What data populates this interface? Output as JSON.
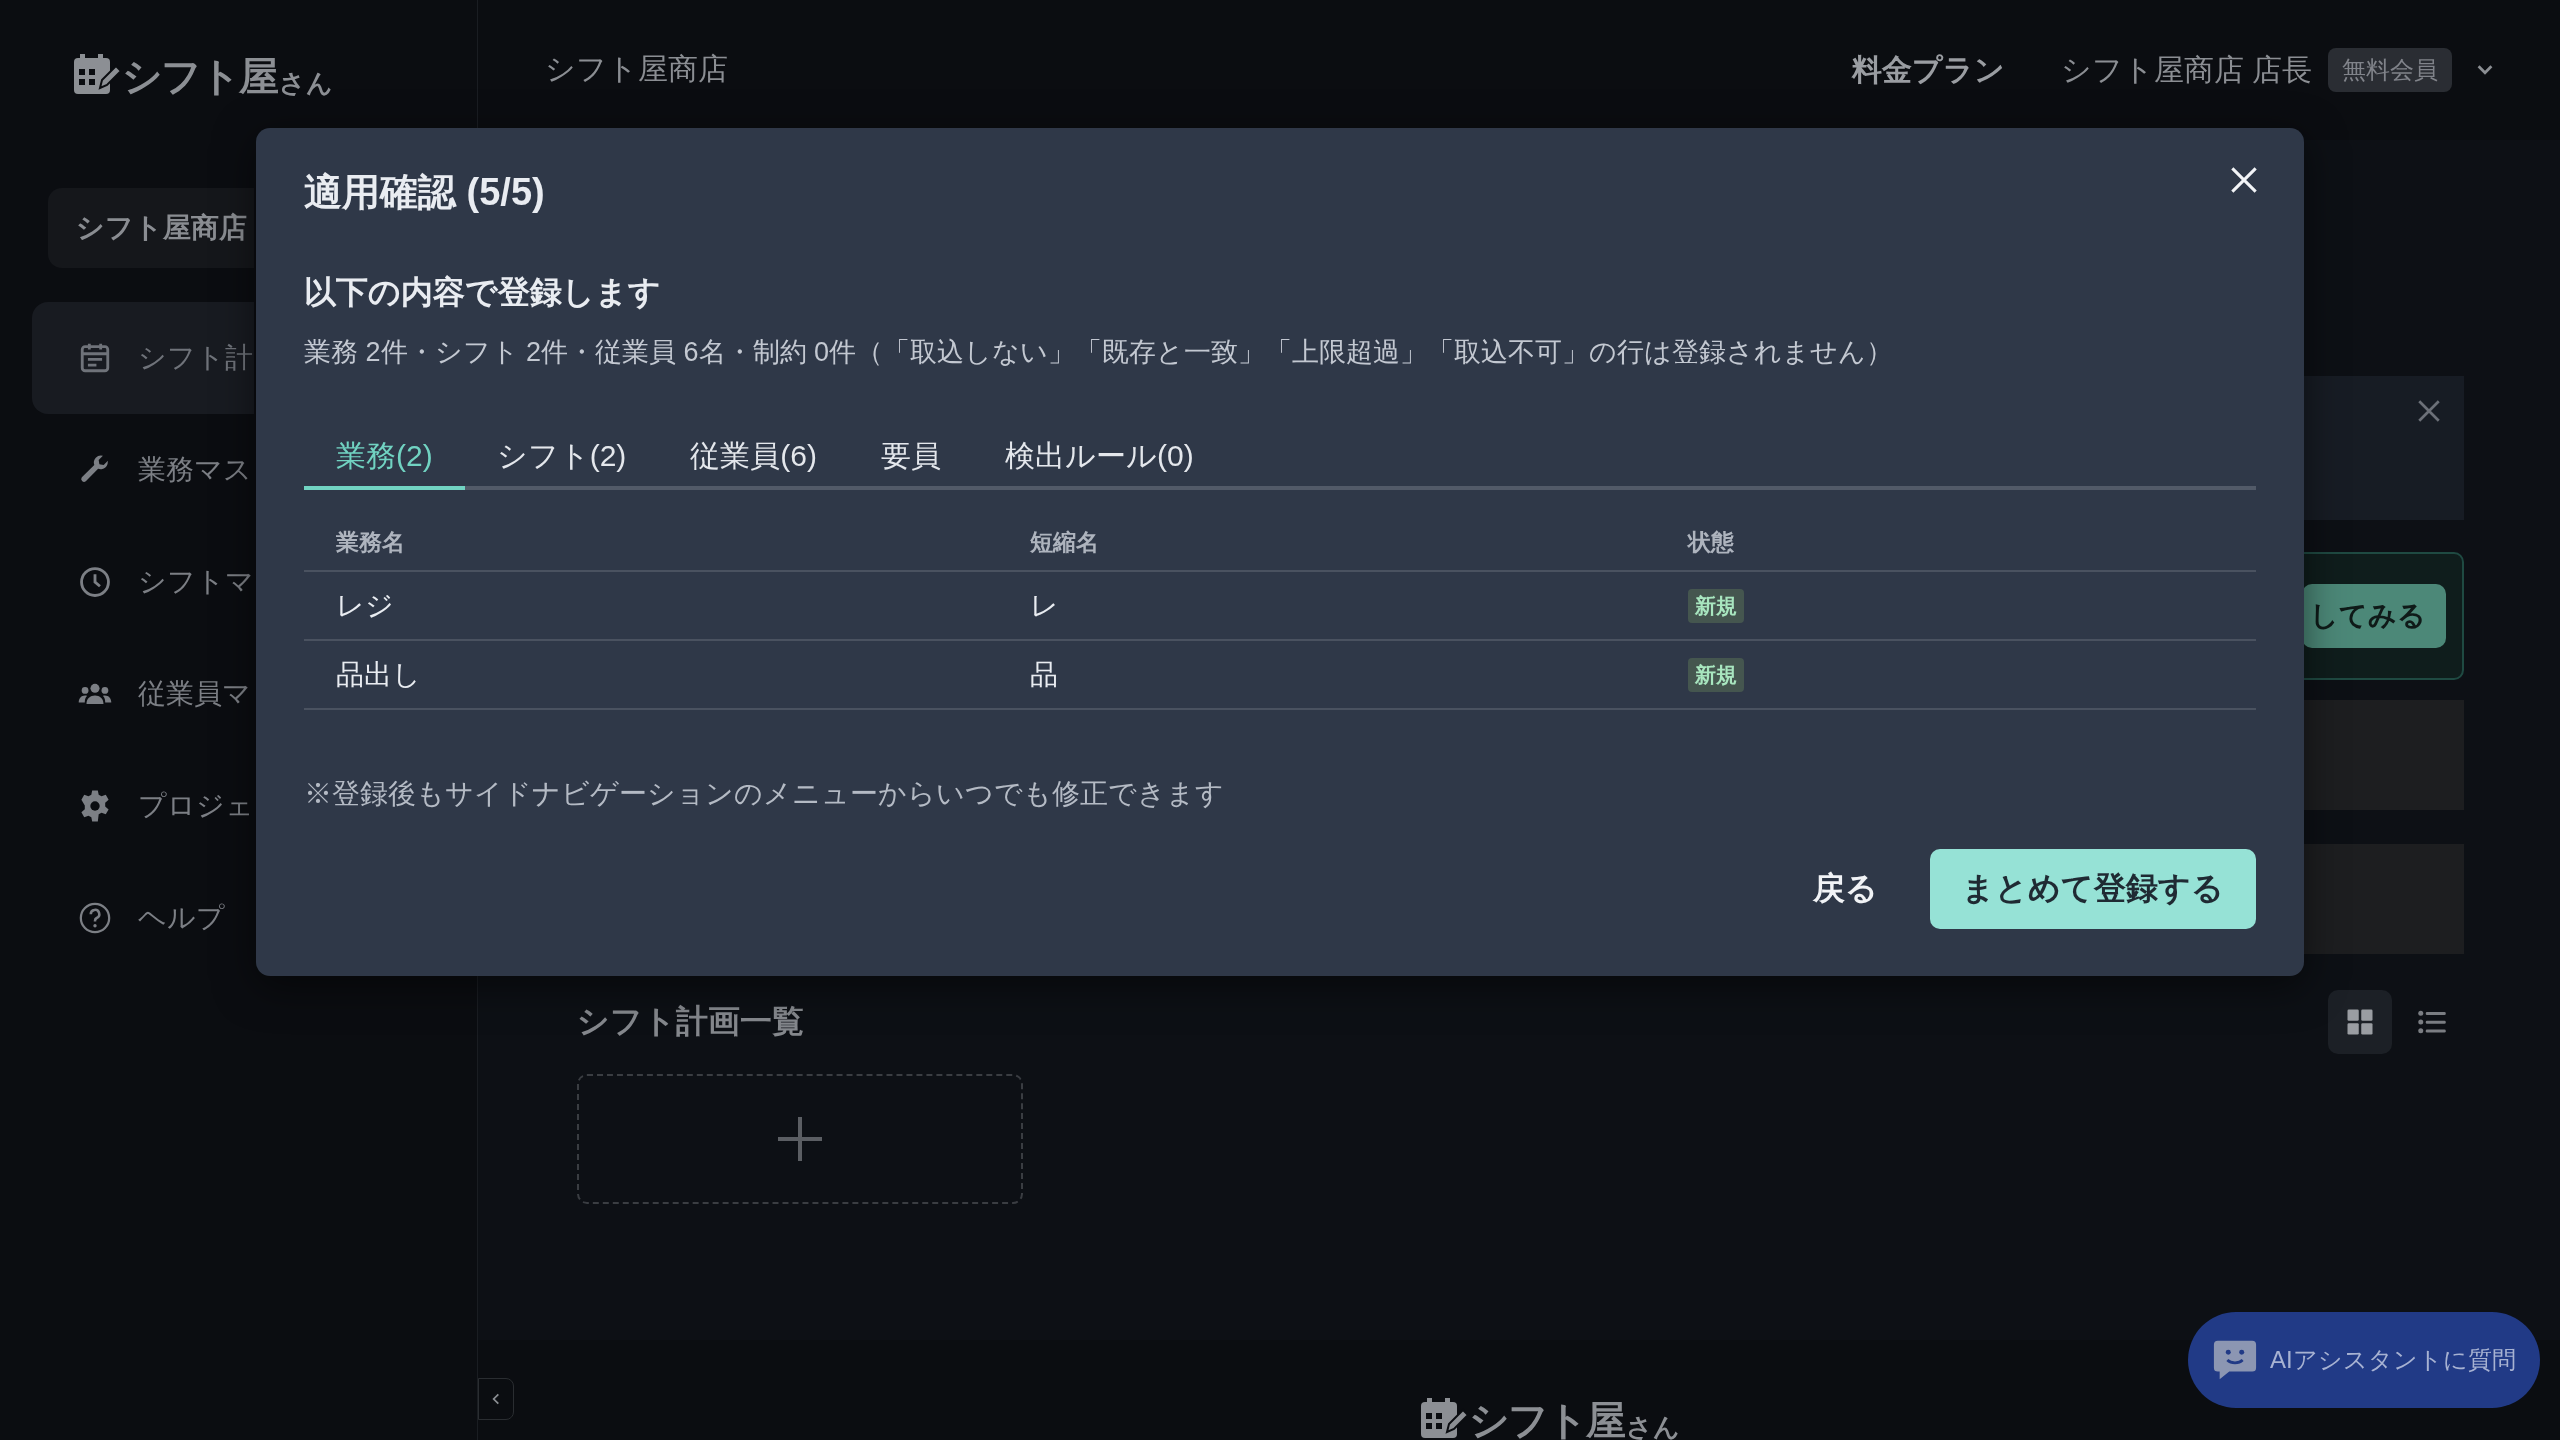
{
  "sidebar": {
    "logo": {
      "name": "シフト屋",
      "suffix": "さん"
    },
    "shop_button": "シフト屋商店",
    "items": [
      {
        "label": "シフト計",
        "kind": "calendar",
        "selected": true
      },
      {
        "label": "業務マス",
        "kind": "wrench",
        "selected": false
      },
      {
        "label": "シフトマ",
        "kind": "clock",
        "selected": false
      },
      {
        "label": "従業員マ",
        "kind": "users",
        "selected": false
      },
      {
        "label": "プロジェ",
        "kind": "gear",
        "selected": false
      },
      {
        "label": "ヘルプ",
        "kind": "help",
        "selected": false
      }
    ]
  },
  "header": {
    "breadcrumb": "シフト屋商店",
    "plan_link": "料金プラン",
    "user": "シフト屋商店 店長",
    "badge": "無料会員"
  },
  "background": {
    "trial_button": "してみる",
    "section_title": "シフト計画一覧",
    "view_modes": [
      {
        "kind": "grid",
        "selected": true
      },
      {
        "kind": "list",
        "selected": false
      }
    ]
  },
  "dialog": {
    "title": "適用確認 (5/5)",
    "heading": "以下の内容で登録します",
    "summary": "業務 2件・シフト 2件・従業員 6名・制約 0件（「取込しない」「既存と一致」「上限超過」「取込不可」の行は登録されません）",
    "tabs": [
      {
        "label": "業務(2)",
        "selected": true
      },
      {
        "label": "シフト(2)",
        "selected": false
      },
      {
        "label": "従業員(6)",
        "selected": false
      },
      {
        "label": "要員",
        "selected": false
      },
      {
        "label": "検出ルール(0)",
        "selected": false
      }
    ],
    "table": {
      "columns": [
        "業務名",
        "短縮名",
        "状態"
      ],
      "rows": [
        [
          "レジ",
          "レ",
          "新規"
        ],
        [
          "品出し",
          "品",
          "新規"
        ]
      ]
    },
    "note": "※登録後もサイドナビゲーションのメニューからいつでも修正できます",
    "back_button": "戻る",
    "submit_button": "まとめて登録する"
  },
  "chat_button": "AIアシスタントに質問",
  "footer_logo": {
    "name": "シフト屋",
    "suffix": "さん"
  }
}
